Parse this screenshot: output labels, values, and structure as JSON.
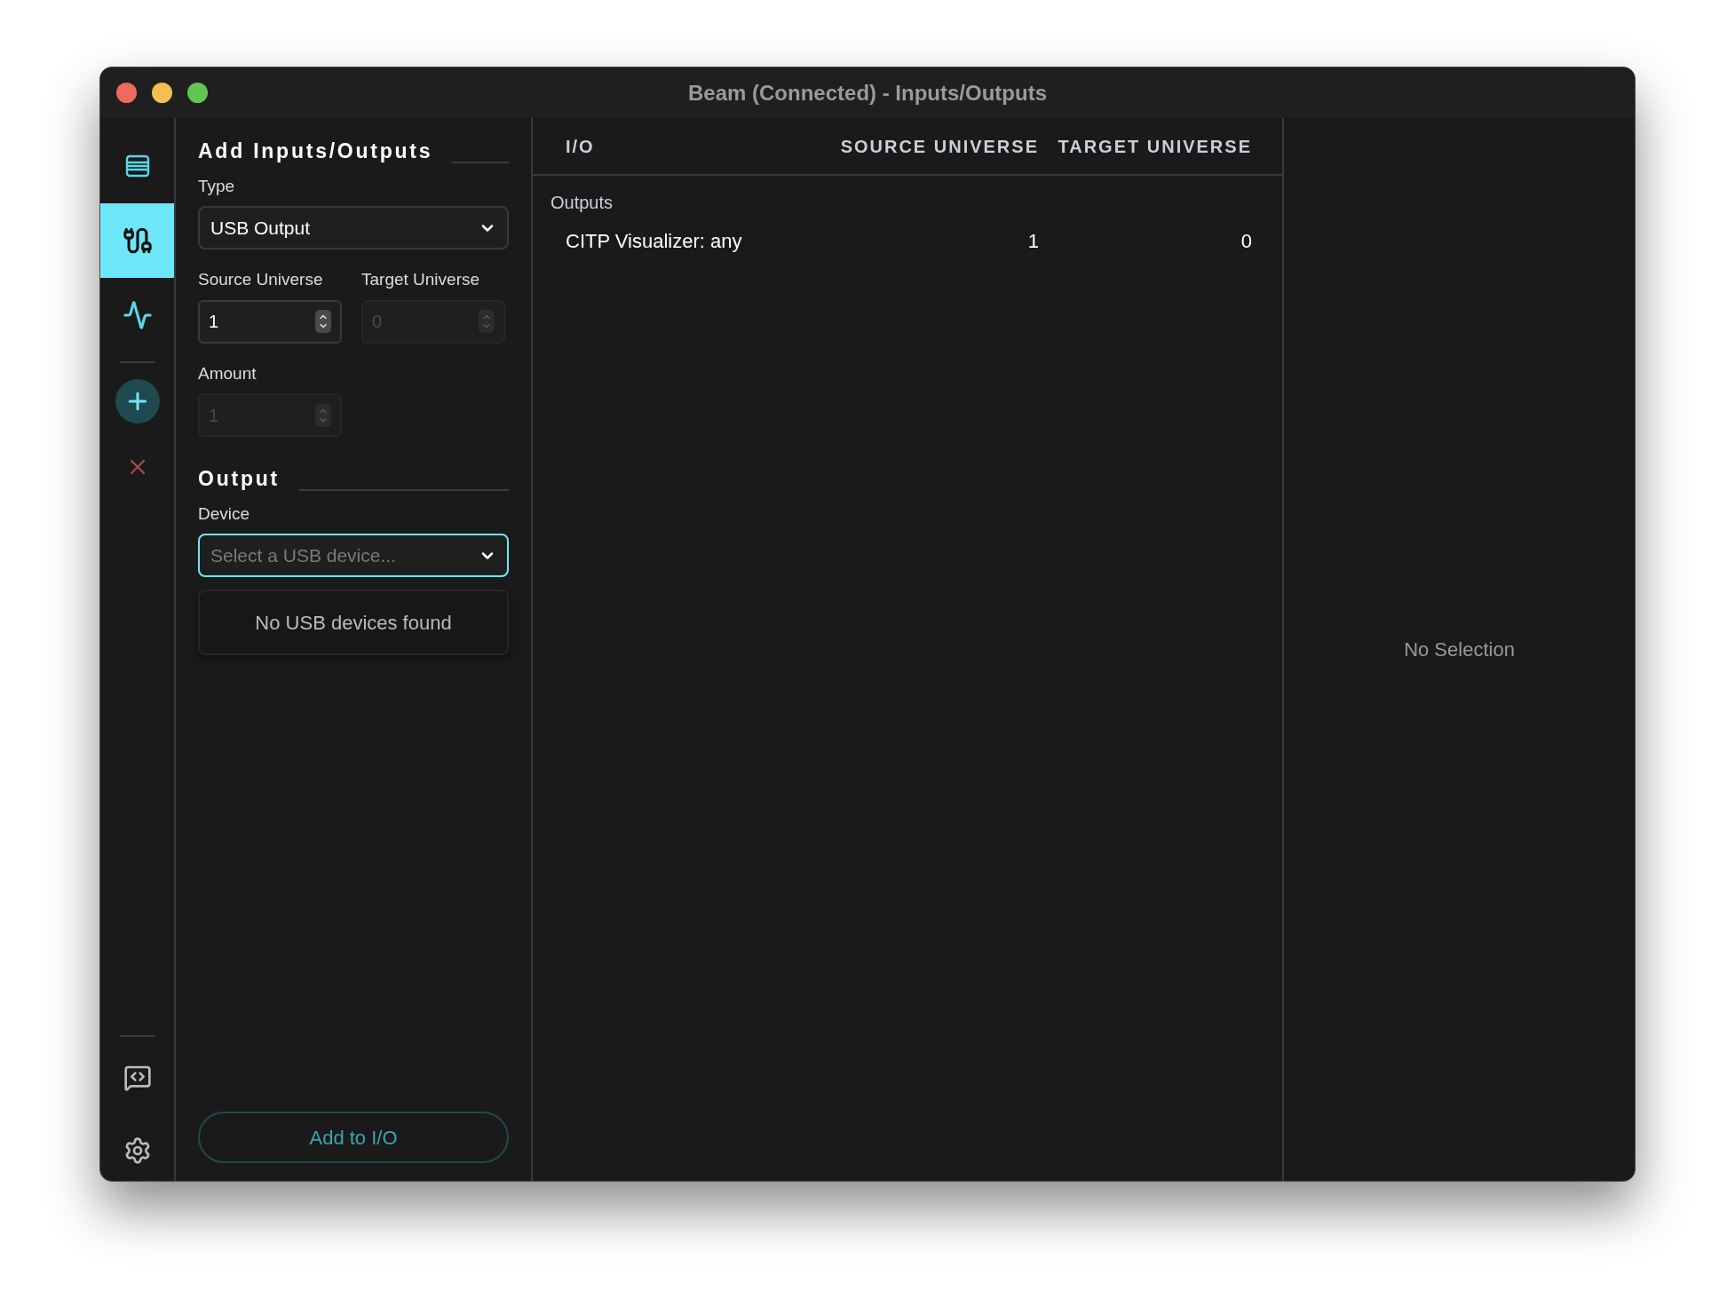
{
  "window": {
    "title": "Beam (Connected) - Inputs/Outputs"
  },
  "sidebar": {
    "items": [
      {
        "selected": false
      },
      {
        "selected": true
      },
      {
        "selected": false
      }
    ]
  },
  "add_panel": {
    "title": "Add Inputs/Outputs",
    "type": {
      "label": "Type",
      "value": "USB Output"
    },
    "source_universe": {
      "label": "Source Universe",
      "value": "1",
      "disabled": false
    },
    "target_universe": {
      "label": "Target Universe",
      "value": "0",
      "disabled": true
    },
    "amount": {
      "label": "Amount",
      "value": "1",
      "disabled": true
    }
  },
  "output": {
    "title": "Output",
    "device": {
      "label": "Device",
      "placeholder": "Select a USB device...",
      "focused": true
    },
    "empty_message": "No USB devices found"
  },
  "add_button": "Add to I/O",
  "table": {
    "columns": [
      "I/O",
      "SOURCE UNIVERSE",
      "TARGET UNIVERSE"
    ],
    "groups": [
      {
        "label": "Outputs",
        "rows": [
          {
            "cells": [
              "CITP Visualizer: any",
              "1",
              "0"
            ]
          }
        ]
      }
    ]
  },
  "detail": {
    "message": "No Selection"
  }
}
